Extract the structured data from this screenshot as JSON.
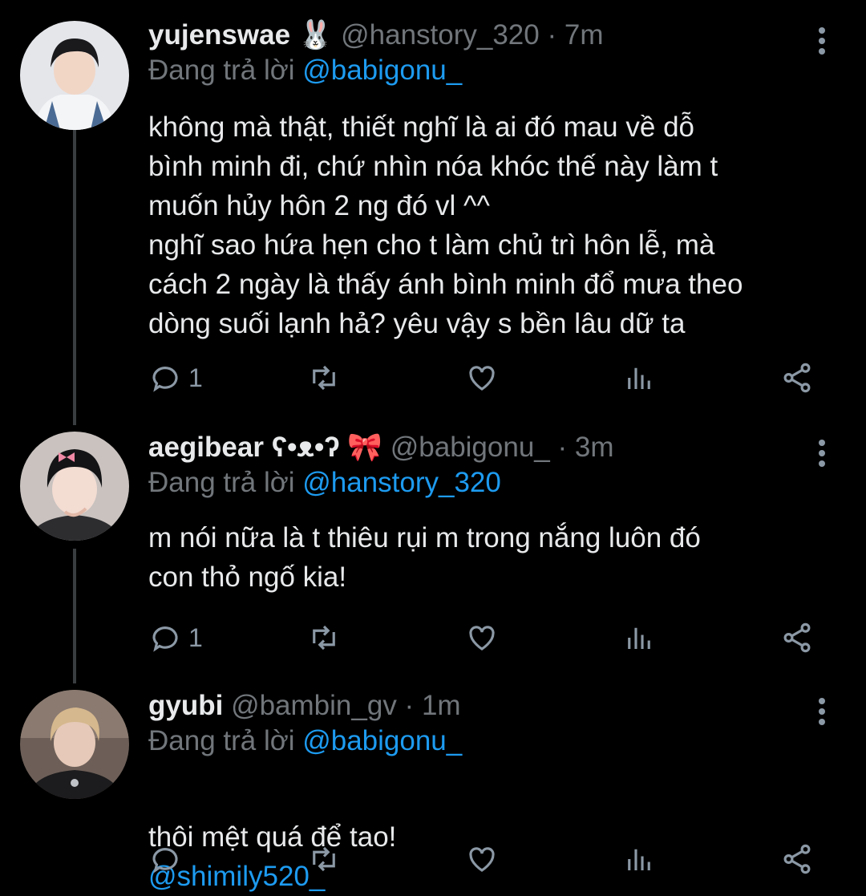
{
  "tweets": [
    {
      "name": "yujenswae",
      "emoji": "🐰",
      "handle": "@hanstory_320",
      "time": "7m",
      "reply_prefix": "Đang trả lời",
      "reply_to": "@babigonu_",
      "text": "không mà thật, thiết nghĩ là ai đó mau về dỗ\nbình minh đi, chứ nhìn nóa khóc thế này làm t\nmuốn hủy hôn 2 ng đó vl ^^\nnghĩ sao hứa hẹn cho t làm chủ trì hôn lễ, mà\ncách 2 ngày là thấy ánh bình minh đổ mưa theo\ndòng suối lạnh hả? yêu vậy s bền lâu dữ ta",
      "reply_count": "1",
      "avatar_color": "#d9dde3"
    },
    {
      "name": "aegibear ʕ•ᴥ•ʔ",
      "emoji": "🎀",
      "handle": "@babigonu_",
      "time": "3m",
      "reply_prefix": "Đang trả lời",
      "reply_to": "@hanstory_320",
      "text": "m nói nữa là t thiêu rụi m trong nắng luôn đó\ncon thỏ ngố kia!",
      "reply_count": "1",
      "avatar_color": "#cfc7c4"
    },
    {
      "name": "gyubi",
      "emoji": "",
      "handle": "@bambin_gv",
      "time": "1m",
      "reply_prefix": "Đang trả lời",
      "reply_to": "@babigonu_",
      "text_plain": "thôi mệt quá để tao!",
      "text_mention": "@shimily520_",
      "reply_count": "",
      "avatar_color": "#5a4a44"
    }
  ],
  "separator": " · ",
  "icons": [
    "reply-icon",
    "retweet-icon",
    "like-icon",
    "stats-icon",
    "share-icon",
    "more-icon"
  ],
  "colors": {
    "background": "#000000",
    "link": "#1d9bf0",
    "muted": "#71767b",
    "text": "#e7e9ea"
  }
}
